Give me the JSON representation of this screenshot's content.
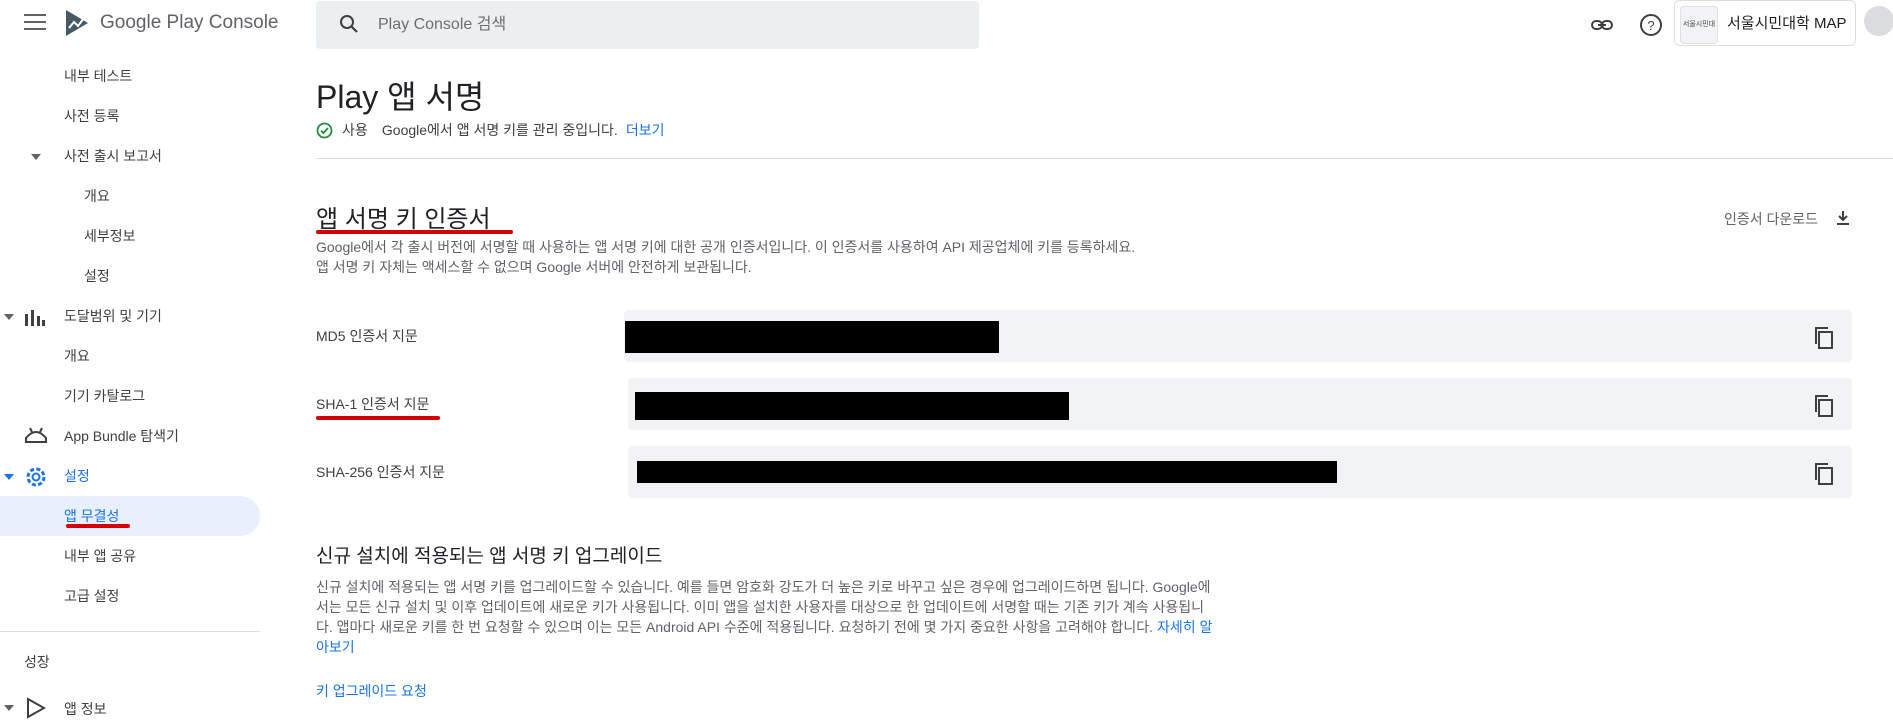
{
  "header": {
    "app_title": "Google Play Console",
    "search_placeholder": "Play Console 검색",
    "selected_app_name": "서울시민대학 MAP",
    "selected_app_thumb_text": "서울시민대학"
  },
  "sidebar": {
    "items": [
      {
        "label": "내부 테스트"
      },
      {
        "label": "사전 등록"
      },
      {
        "label": "사전 출시 보고서"
      },
      {
        "label": "개요"
      },
      {
        "label": "세부정보"
      },
      {
        "label": "설정"
      },
      {
        "label": "도달범위 및 기기"
      },
      {
        "label": "개요"
      },
      {
        "label": "기기 카탈로그"
      },
      {
        "label": "App Bundle 탐색기"
      },
      {
        "label": "설정"
      },
      {
        "label": "앱 무결성"
      },
      {
        "label": "내부 앱 공유"
      },
      {
        "label": "고급 설정"
      },
      {
        "label": "성장"
      },
      {
        "label": "앱 정보"
      }
    ]
  },
  "main": {
    "title": "Play 앱 서명",
    "status_text": "사용 ⠀Google에서 앱 서명 키를 관리 중입니다.",
    "status_link": "더보기",
    "cert_section": {
      "heading": "앱 서명 키 인증서",
      "download_label": "인증서 다운로드",
      "description_line1": "Google에서 각 출시 버전에 서명할 때 사용하는 앱 서명 키에 대한 공개 인증서입니다. 이 인증서를 사용하여 API 제공업체에 키를 등록하세요.",
      "description_line2": "앱 서명 키 자체는 액세스할 수 없으며 Google 서버에 안전하게 보관됩니다.",
      "fields": [
        {
          "label": "MD5 인증서 지문"
        },
        {
          "label": "SHA-1 인증서 지문"
        },
        {
          "label": "SHA-256 인증서 지문"
        }
      ]
    },
    "upgrade_section": {
      "heading": "신규 설치에 적용되는 앱 서명 키 업그레이드",
      "description": "신규 설치에 적용되는 앱 서명 키를 업그레이드할 수 있습니다. 예를 들면 암호화 강도가 더 높은 키로 바꾸고 싶은 경우에 업그레이드하면 됩니다. Google에서는 모든 신규 설치 및 이후 업데이트에 새로운 키가 사용됩니다. 이미 앱을 설치한 사용자를 대상으로 한 업데이트에 서명할 때는 기존 키가 계속 사용됩니다. 앱마다 새로운 키를 한 번 요청할 수 있으며 이는 모든 Android API 수준에 적용됩니다. 요청하기 전에 몇 가지 중요한 사항을 고려해야 합니다.",
      "learn_more": "자세히 알아보기",
      "request_button": "키 업그레이드 요청"
    }
  },
  "colors": {
    "accent": "#1a73e8",
    "annotation": "#d50000",
    "success": "#1e8e3e"
  }
}
